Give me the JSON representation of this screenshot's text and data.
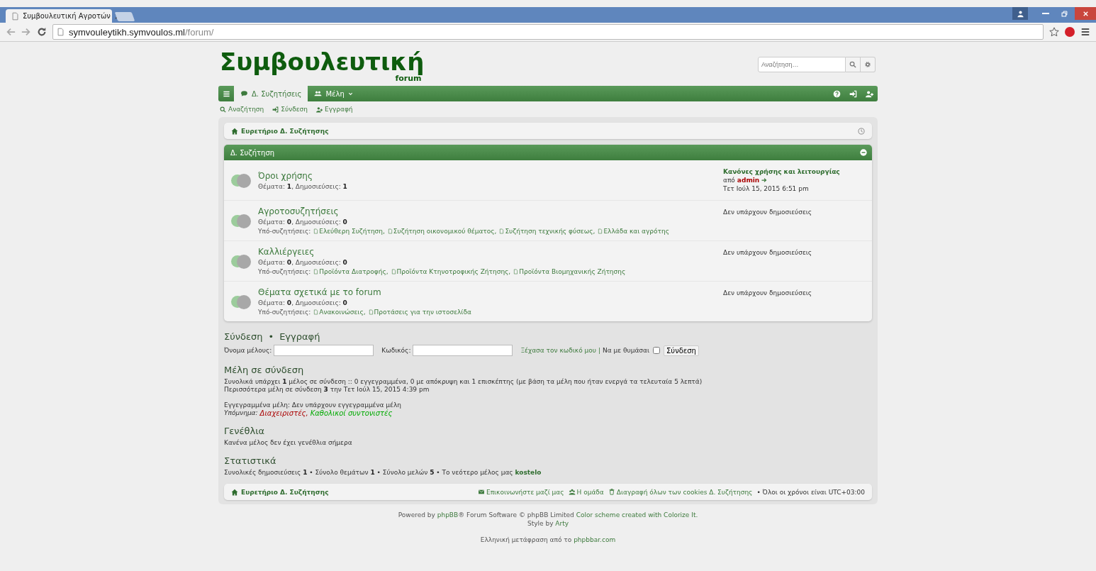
{
  "browser": {
    "tab_title": "Συμβουλευτική Αγροτών",
    "url_host": "symvouleytikh.symvoulos.ml",
    "url_path": "/forum/"
  },
  "logo": {
    "title": "Συμβουλευτική",
    "subtitle": "forum"
  },
  "search": {
    "placeholder": "Αναζήτηση…"
  },
  "navbar": {
    "tabs": [
      {
        "label": "Δ. Συζητήσεις",
        "selected": true,
        "kind": "forum"
      },
      {
        "label": "Μέλη",
        "selected": false,
        "kind": "members"
      }
    ]
  },
  "quick_links": [
    {
      "label": "Αναζήτηση",
      "kind": "search"
    },
    {
      "label": "Σύνδεση",
      "kind": "login"
    },
    {
      "label": "Εγγραφή",
      "kind": "register"
    }
  ],
  "breadcrumb": "Ευρετήριο Δ. Συζήτησης",
  "category": {
    "title": "Δ. Συζήτηση",
    "forums": [
      {
        "title": "Όροι χρήσης",
        "stats": "Θέματα: **1**, Δημοσιεύσεις: **1**",
        "last_post": {
          "title": "Κανόνες χρήσης και λειτουργίας",
          "by": "από",
          "author": "admin",
          "date": "Τετ Ιούλ 15, 2015 6:51 pm"
        }
      },
      {
        "title": "Αγροτοσυζητήσεις",
        "stats": "Θέματα: **0**, Δημοσιεύσεις: **0**",
        "subforums_label": "Υπό-συζητήσεις:",
        "subforums": [
          "Ελεύθερη Συζήτηση,",
          "Συζήτηση οικονομικού θέματος,",
          "Συζήτηση τεχνικής φύσεως,",
          "Ελλάδα και αγρότης"
        ],
        "no_posts": "Δεν υπάρχουν δημοσιεύσεις"
      },
      {
        "title": "Καλλιέργειες",
        "stats": "Θέματα: **0**, Δημοσιεύσεις: **0**",
        "subforums_label": "Υπό-συζητήσεις:",
        "subforums": [
          "Προϊόντα Διατροφής,",
          "Προϊόντα Κτηνοτροφικής Ζήτησης,",
          "Προϊόντα Βιομηχανικής Ζήτησης"
        ],
        "no_posts": "Δεν υπάρχουν δημοσιεύσεις"
      },
      {
        "title": "Θέματα σχετικά με το forum",
        "stats": "Θέματα: **0**, Δημοσιεύσεις: **0**",
        "subforums_label": "Υπό-συζητήσεις:",
        "subforums": [
          "Ανακοινώσεις,",
          "Προτάσεις για την ιστοσελίδα"
        ],
        "no_posts": "Δεν υπάρχουν δημοσιεύσεις"
      }
    ]
  },
  "login": {
    "heading_login": "Σύνδεση",
    "heading_sep": "•",
    "heading_register": "Εγγραφή",
    "username_label": "Όνομα μέλους:",
    "password_label": "Κωδικός:",
    "forgot": "Ξέχασα τον κωδικό μου",
    "sep": "|",
    "remember_label": "Να με θυμάσαι",
    "remember_checked": false,
    "button": "Σύνδεση"
  },
  "online": {
    "heading": "Μέλη σε σύνδεση",
    "lines": [
      "Συνολικά υπάρχει **1** μέλος σε σύνδεση :: 0 εγγεγραμμένα, 0 με απόκρυψη και 1 επισκέπτης (με βάση τα μέλη που ήταν ενεργά τα τελευταία 5 λεπτά)",
      "Περισσότερα μέλη σε σύνδεση **3** την Τετ Ιούλ 15, 2015 4:39 pm"
    ],
    "registered": "Εγγεγραμμένα μέλη: Δεν υπάρχουν εγγεγραμμένα μέλη",
    "legend_label": "Υπόμνημα:",
    "legend": [
      {
        "label": "Διαχειριστές,",
        "color": "#aa0000"
      },
      {
        "label": "Καθολικοί συντονιστές",
        "color": "#00aa00"
      }
    ]
  },
  "birthdays": {
    "heading": "Γενέθλια",
    "text": "Κανένα μέλος δεν έχει γενέθλια σήμερα"
  },
  "statistics": {
    "heading": "Στατιστικά",
    "text": "Συνολικές δημοσιεύσεις **1** • Σύνολο θεμάτων **1** • Σύνολο μελών **5** • Το νεότερο μέλος μας ",
    "newest": "kostelo"
  },
  "footer_bar": {
    "index": "Ευρετήριο Δ. Συζήτησης",
    "links": [
      {
        "label": "Επικοινωνήστε μαζί μας",
        "kind": "mail"
      },
      {
        "label": "Η ομάδα",
        "kind": "team"
      },
      {
        "label": "Διαγραφή όλων των cookies Δ. Συζήτησης",
        "kind": "trash"
      }
    ],
    "timezone": "• Όλοι οι χρόνοι είναι UTC+03:00"
  },
  "credits": {
    "powered": [
      {
        "text": "Powered by "
      },
      {
        "link": "phpBB"
      },
      {
        "text": "® Forum Software © phpBB Limited "
      },
      {
        "link": "Color scheme created with Colorize It."
      }
    ],
    "style": [
      {
        "text": "Style by "
      },
      {
        "link": "Arty"
      }
    ],
    "translation": [
      {
        "text": "Ελληνική μετάφραση από το "
      },
      {
        "link": "phpbbar.com"
      }
    ]
  }
}
